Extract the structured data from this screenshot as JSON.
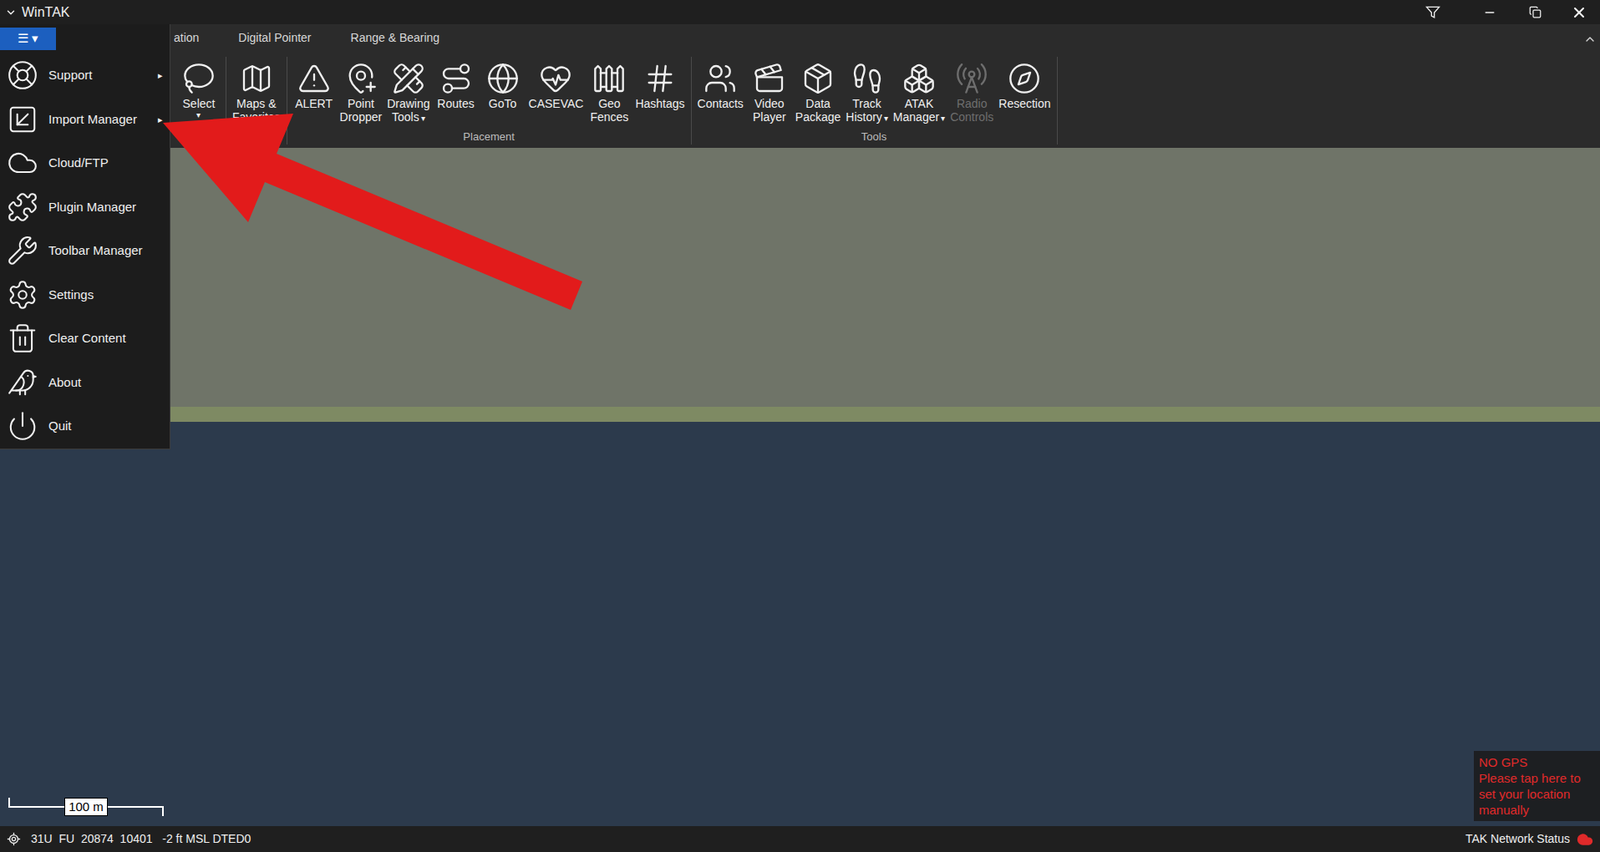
{
  "window": {
    "title": "WinTAK"
  },
  "main_menu": {
    "button": "☰ ▾",
    "open": true,
    "items": [
      {
        "label": "Support",
        "arrow": "▸"
      },
      {
        "label": "Import Manager",
        "arrow": "▸"
      },
      {
        "label": "Cloud/FTP"
      },
      {
        "label": "Plugin Manager"
      },
      {
        "label": "Toolbar Manager"
      },
      {
        "label": "Settings"
      },
      {
        "label": "Clear Content"
      },
      {
        "label": "About"
      },
      {
        "label": "Quit"
      }
    ]
  },
  "tabs": [
    {
      "label": "ation",
      "selected": false
    },
    {
      "label": "Digital Pointer",
      "selected": false
    },
    {
      "label": "Range & Bearing",
      "selected": false
    }
  ],
  "ribbon": {
    "groups": [
      {
        "label": "",
        "tools": [
          {
            "lines": [
              "Select"
            ],
            "arrow": "▾",
            "arrow_below": true,
            "disabled": false
          }
        ]
      },
      {
        "label": "",
        "tools": [
          {
            "lines": [
              "Maps &",
              "Favorites"
            ],
            "disabled": false
          }
        ]
      },
      {
        "label": "Placement",
        "tools": [
          {
            "lines": [
              "ALERT"
            ],
            "disabled": false
          },
          {
            "lines": [
              "Point",
              "Dropper"
            ],
            "disabled": false
          },
          {
            "lines": [
              "Drawing",
              "Tools"
            ],
            "arrow": "▾",
            "disabled": false
          },
          {
            "lines": [
              "Routes"
            ],
            "disabled": false
          },
          {
            "lines": [
              "GoTo"
            ],
            "disabled": false
          },
          {
            "lines": [
              "CASEVAC"
            ],
            "disabled": false
          },
          {
            "lines": [
              "Geo",
              "Fences"
            ],
            "disabled": false
          },
          {
            "lines": [
              "Hashtags"
            ],
            "disabled": false
          }
        ]
      },
      {
        "label": "Tools",
        "tools": [
          {
            "lines": [
              "Contacts"
            ],
            "disabled": false
          },
          {
            "lines": [
              "Video",
              "Player"
            ],
            "disabled": false
          },
          {
            "lines": [
              "Data",
              "Package"
            ],
            "disabled": false
          },
          {
            "lines": [
              "Track",
              "History"
            ],
            "arrow": "▾",
            "disabled": false
          },
          {
            "lines": [
              "ATAK",
              "Manager"
            ],
            "arrow": "▾",
            "disabled": false
          },
          {
            "lines": [
              "Radio",
              "Controls"
            ],
            "disabled": true
          },
          {
            "lines": [
              "Resection"
            ],
            "disabled": false
          }
        ]
      }
    ]
  },
  "map": {
    "scale": "100 m",
    "gps_warning": {
      "title": "NO GPS",
      "message": "Please tap here to set your location manually"
    }
  },
  "status_bar": {
    "coordinates": "31U  FU  20874  10401   -2 ft MSL DTED0",
    "network": "TAK Network Status"
  }
}
